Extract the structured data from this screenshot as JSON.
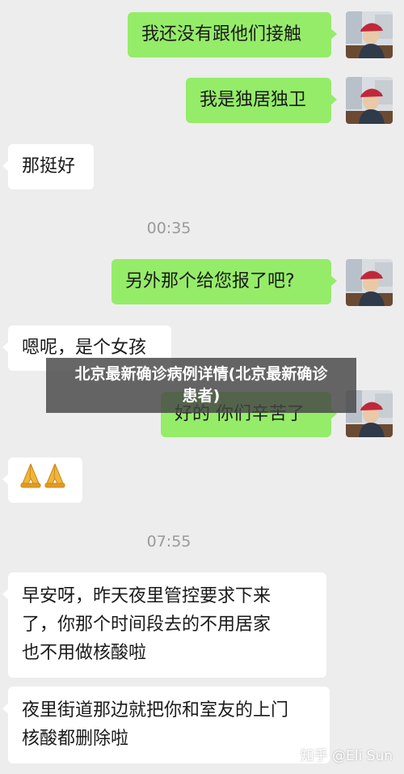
{
  "colors": {
    "background": "#ededed",
    "outgoing_bubble": "#95ec69",
    "incoming_bubble": "#ffffff",
    "timestamp": "#9a9a9a"
  },
  "messages": [
    {
      "direction": "out",
      "text": "我还没有跟他们接触"
    },
    {
      "direction": "out",
      "text": "我是独居独卫"
    },
    {
      "direction": "in",
      "text": "那挺好"
    },
    {
      "direction": "out",
      "text": "另外那个给您报了吧?"
    },
    {
      "direction": "in",
      "text": "嗯呢，是个女孩"
    },
    {
      "direction": "out",
      "text": "好的 你们辛苦了"
    },
    {
      "direction": "in",
      "text": "",
      "icon": "praying-hands-icon"
    },
    {
      "direction": "in",
      "lines": [
        "早安呀，昨天夜里管控要求下来",
        "了，你那个时间段去的不用居家",
        "也不用做核酸啦"
      ]
    },
    {
      "direction": "in",
      "lines": [
        "夜里街道那边就把你和室友的上门",
        "核酸都删除啦"
      ]
    }
  ],
  "timestamps": [
    "00:35",
    "07:55"
  ],
  "overlay_title": {
    "line1": "北京最新确诊病例详情(北京最新确诊",
    "line2": "患者)"
  },
  "watermark": "知乎 @Eli Sun"
}
